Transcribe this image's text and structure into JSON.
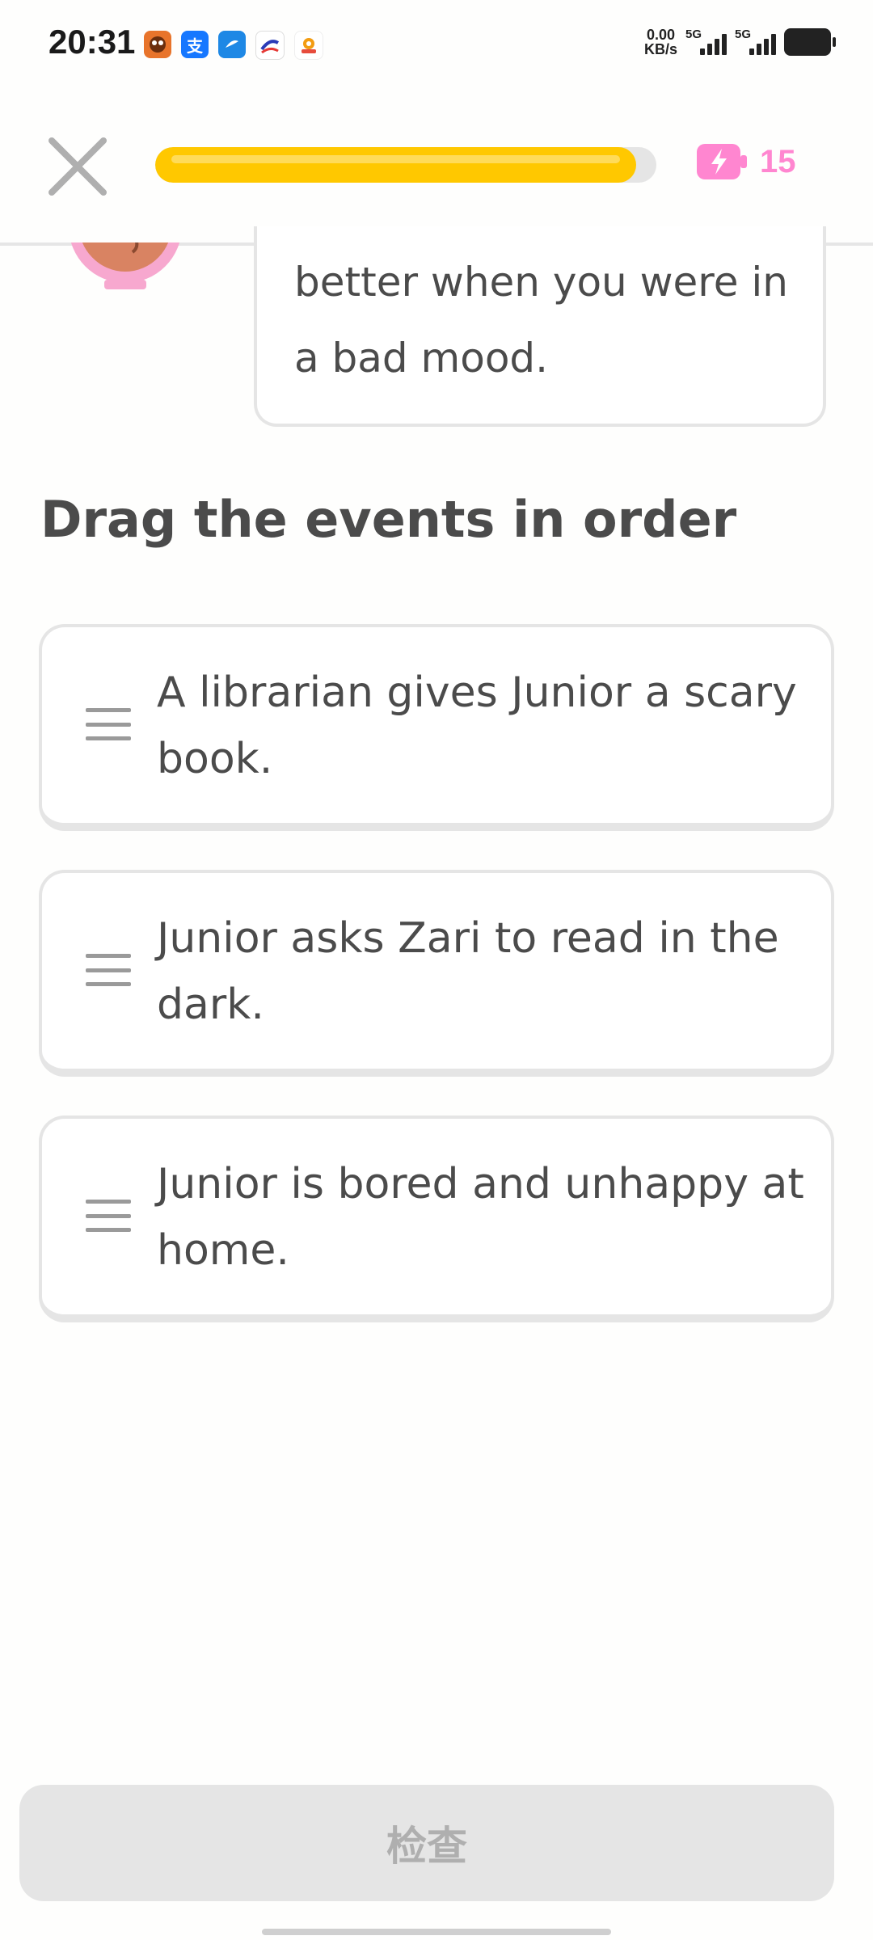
{
  "status_bar": {
    "time": "20:31",
    "net_speed_value": "0.00",
    "net_speed_unit": "KB/s",
    "signal_1": "5G",
    "signal_2": "5G",
    "app_icons": [
      "tiger-app-icon",
      "alipay-icon",
      "browser-icon",
      "bank-app-icon",
      "camera-app-icon"
    ]
  },
  "top_bar": {
    "progress_fraction": 0.96,
    "energy_count": "15",
    "energy_color": "#FF86D0",
    "progress_color": "#FFC800"
  },
  "story": {
    "bubble_text": "better when you were in a bad mood."
  },
  "prompt": {
    "title": "Drag the events in order"
  },
  "events": [
    {
      "text": "A librarian gives Junior a scary book."
    },
    {
      "text": "Junior asks Zari to read in the dark."
    },
    {
      "text": "Junior is bored and unhappy at home."
    }
  ],
  "footer": {
    "check_label": "检查"
  }
}
